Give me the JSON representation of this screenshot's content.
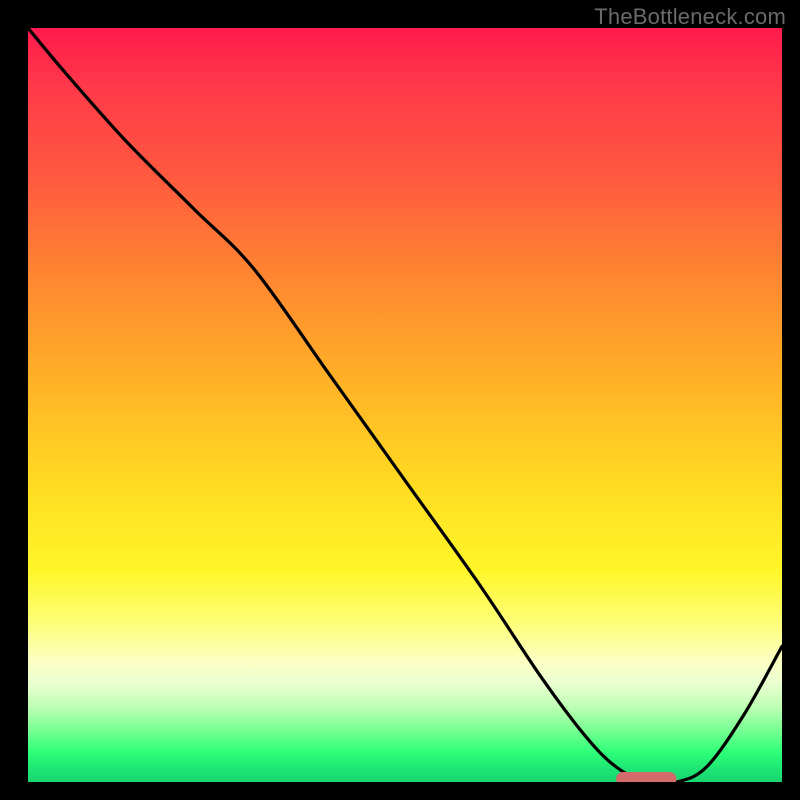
{
  "watermark": "TheBottleneck.com",
  "colors": {
    "frame": "#000000",
    "curve": "#000000",
    "marker": "#d46a6a",
    "gradient_top": "#ff1a4d",
    "gradient_bottom": "#19d66f"
  },
  "chart_data": {
    "type": "line",
    "title": "",
    "xlabel": "",
    "ylabel": "",
    "xlim": [
      0,
      100
    ],
    "ylim": [
      0,
      100
    ],
    "grid": false,
    "legend": false,
    "series": [
      {
        "name": "bottleneck-curve",
        "x": [
          0,
          5,
          13,
          22,
          30,
          40,
          50,
          60,
          68,
          74,
          78,
          82,
          86,
          90,
          95,
          100
        ],
        "y": [
          100,
          94,
          85,
          76,
          68,
          54,
          40,
          26,
          14,
          6,
          2,
          0,
          0,
          2,
          9,
          18
        ]
      }
    ],
    "marker": {
      "shape": "rounded-bar",
      "x_start": 78,
      "x_end": 86,
      "y": 0,
      "color": "#d46a6a"
    }
  }
}
